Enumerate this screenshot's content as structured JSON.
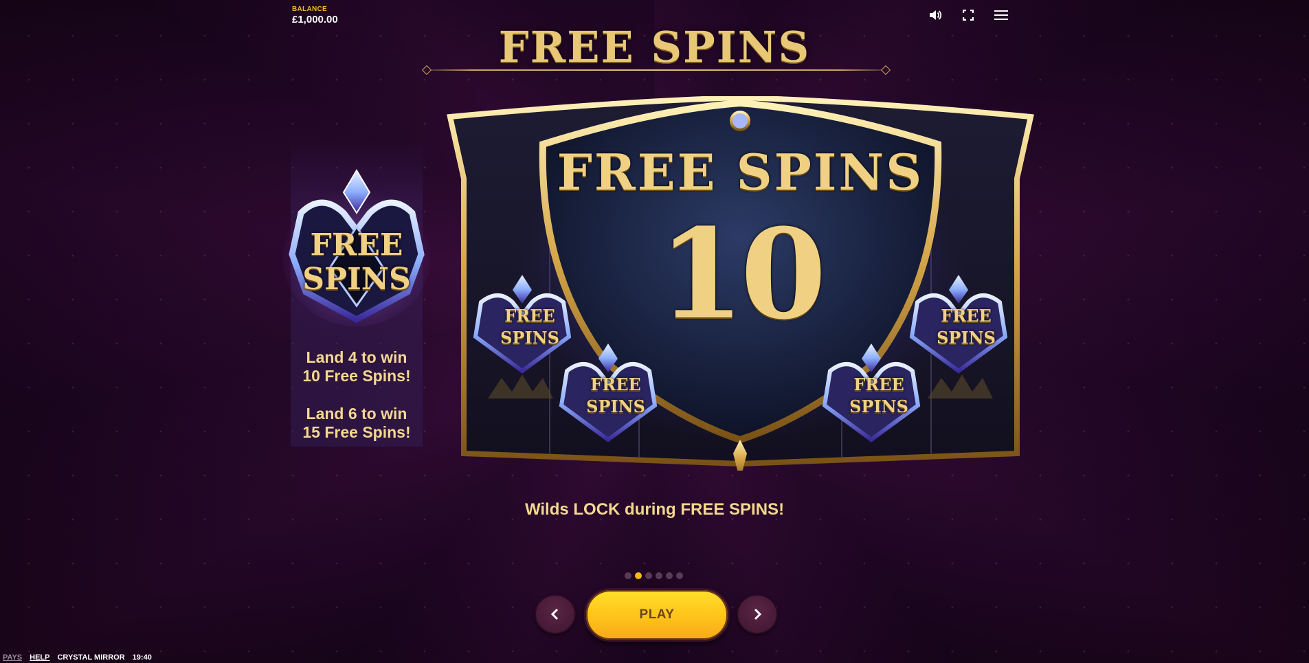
{
  "balance": {
    "label": "BALANCE",
    "value": "£1,000.00"
  },
  "top_icons": [
    "speaker-icon",
    "fullscreen-icon",
    "menu-icon"
  ],
  "page": {
    "title": "FREE SPINS",
    "symbol_line1": "FREE",
    "symbol_line2": "SPINS",
    "land4_line1": "Land 4 to win",
    "land4_line2": "10 Free Spins!",
    "land6_line1": "Land 6 to win",
    "land6_line2": "15 Free Spins!",
    "banner_title": "FREE SPINS",
    "banner_count": "10",
    "mini_symbol_line1": "FREE",
    "mini_symbol_line2": "SPINS",
    "caption": "Wilds LOCK during FREE SPINS!"
  },
  "pagination": {
    "total": 6,
    "current": 2
  },
  "buttons": {
    "play": "PLAY",
    "prev": "chevron-left-icon",
    "next": "chevron-right-icon"
  },
  "footer": {
    "pays": "PAYS",
    "help": "HELP",
    "game_name": "CRYSTAL MIRROR",
    "time": "19:40"
  },
  "colors": {
    "gold": "#e8c777",
    "accent_yellow": "#f5b81c",
    "play_button": "#ffc51a",
    "background": "#26082a"
  }
}
